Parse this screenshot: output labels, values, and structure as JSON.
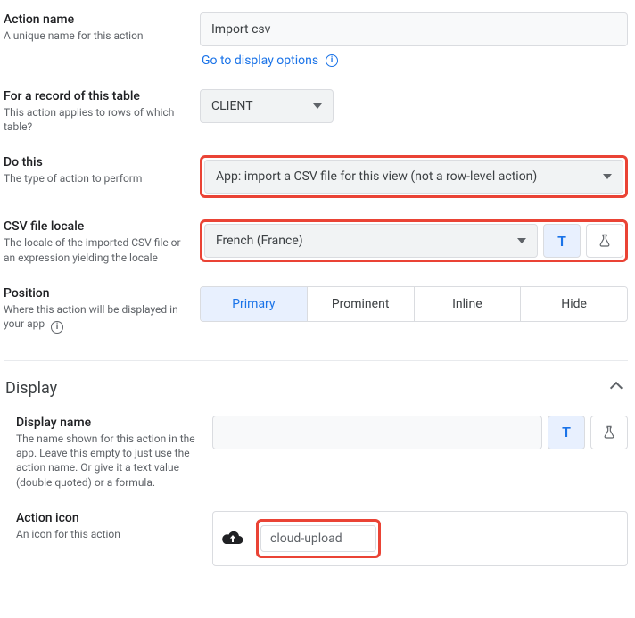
{
  "action_name": {
    "label": "Action name",
    "desc": "A unique name for this action",
    "value": "Import csv",
    "display_link": "Go to display options"
  },
  "table": {
    "label": "For a record of this table",
    "desc": "This action applies to rows of which table?",
    "value": "CLIENT"
  },
  "do_this": {
    "label": "Do this",
    "desc": "The type of action to perform",
    "value": "App: import a CSV file for this view (not a row-level action)"
  },
  "csv_locale": {
    "label": "CSV file locale",
    "desc": "The locale of the imported CSV file or an expression yielding the locale",
    "value": "French (France)"
  },
  "position": {
    "label": "Position",
    "desc": "Where this action will be displayed in your app",
    "options": [
      "Primary",
      "Prominent",
      "Inline",
      "Hide"
    ],
    "selected": "Primary"
  },
  "display_section": "Display",
  "display_name": {
    "label": "Display name",
    "desc": "The name shown for this action in the app. Leave this empty to just use the action name. Or give it a text value (double quoted) or a formula.",
    "value": ""
  },
  "action_icon": {
    "label": "Action icon",
    "desc": "An icon for this action",
    "value": "cloud-upload"
  },
  "glyphs": {
    "T": "T"
  }
}
